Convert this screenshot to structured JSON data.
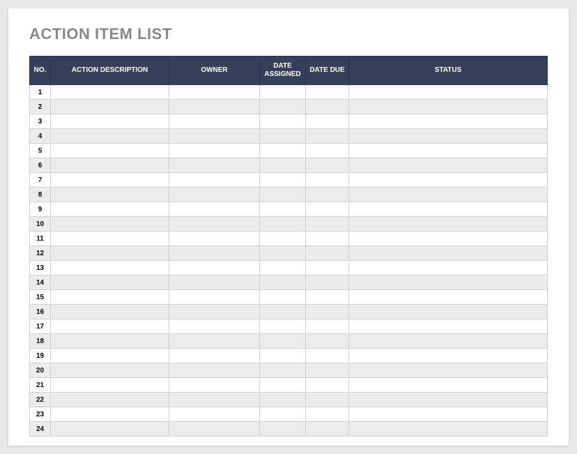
{
  "title": "ACTION ITEM LIST",
  "headers": {
    "no": "NO.",
    "description": "ACTION DESCRIPTION",
    "owner": "OWNER",
    "date_assigned": "DATE ASSIGNED",
    "date_due": "DATE DUE",
    "status": "STATUS"
  },
  "rows": [
    {
      "no": "1",
      "description": "",
      "owner": "",
      "date_assigned": "",
      "date_due": "",
      "status": ""
    },
    {
      "no": "2",
      "description": "",
      "owner": "",
      "date_assigned": "",
      "date_due": "",
      "status": ""
    },
    {
      "no": "3",
      "description": "",
      "owner": "",
      "date_assigned": "",
      "date_due": "",
      "status": ""
    },
    {
      "no": "4",
      "description": "",
      "owner": "",
      "date_assigned": "",
      "date_due": "",
      "status": ""
    },
    {
      "no": "5",
      "description": "",
      "owner": "",
      "date_assigned": "",
      "date_due": "",
      "status": ""
    },
    {
      "no": "6",
      "description": "",
      "owner": "",
      "date_assigned": "",
      "date_due": "",
      "status": ""
    },
    {
      "no": "7",
      "description": "",
      "owner": "",
      "date_assigned": "",
      "date_due": "",
      "status": ""
    },
    {
      "no": "8",
      "description": "",
      "owner": "",
      "date_assigned": "",
      "date_due": "",
      "status": ""
    },
    {
      "no": "9",
      "description": "",
      "owner": "",
      "date_assigned": "",
      "date_due": "",
      "status": ""
    },
    {
      "no": "10",
      "description": "",
      "owner": "",
      "date_assigned": "",
      "date_due": "",
      "status": ""
    },
    {
      "no": "11",
      "description": "",
      "owner": "",
      "date_assigned": "",
      "date_due": "",
      "status": ""
    },
    {
      "no": "12",
      "description": "",
      "owner": "",
      "date_assigned": "",
      "date_due": "",
      "status": ""
    },
    {
      "no": "13",
      "description": "",
      "owner": "",
      "date_assigned": "",
      "date_due": "",
      "status": ""
    },
    {
      "no": "14",
      "description": "",
      "owner": "",
      "date_assigned": "",
      "date_due": "",
      "status": ""
    },
    {
      "no": "15",
      "description": "",
      "owner": "",
      "date_assigned": "",
      "date_due": "",
      "status": ""
    },
    {
      "no": "16",
      "description": "",
      "owner": "",
      "date_assigned": "",
      "date_due": "",
      "status": ""
    },
    {
      "no": "17",
      "description": "",
      "owner": "",
      "date_assigned": "",
      "date_due": "",
      "status": ""
    },
    {
      "no": "18",
      "description": "",
      "owner": "",
      "date_assigned": "",
      "date_due": "",
      "status": ""
    },
    {
      "no": "19",
      "description": "",
      "owner": "",
      "date_assigned": "",
      "date_due": "",
      "status": ""
    },
    {
      "no": "20",
      "description": "",
      "owner": "",
      "date_assigned": "",
      "date_due": "",
      "status": ""
    },
    {
      "no": "21",
      "description": "",
      "owner": "",
      "date_assigned": "",
      "date_due": "",
      "status": ""
    },
    {
      "no": "22",
      "description": "",
      "owner": "",
      "date_assigned": "",
      "date_due": "",
      "status": ""
    },
    {
      "no": "23",
      "description": "",
      "owner": "",
      "date_assigned": "",
      "date_due": "",
      "status": ""
    },
    {
      "no": "24",
      "description": "",
      "owner": "",
      "date_assigned": "",
      "date_due": "",
      "status": ""
    }
  ]
}
